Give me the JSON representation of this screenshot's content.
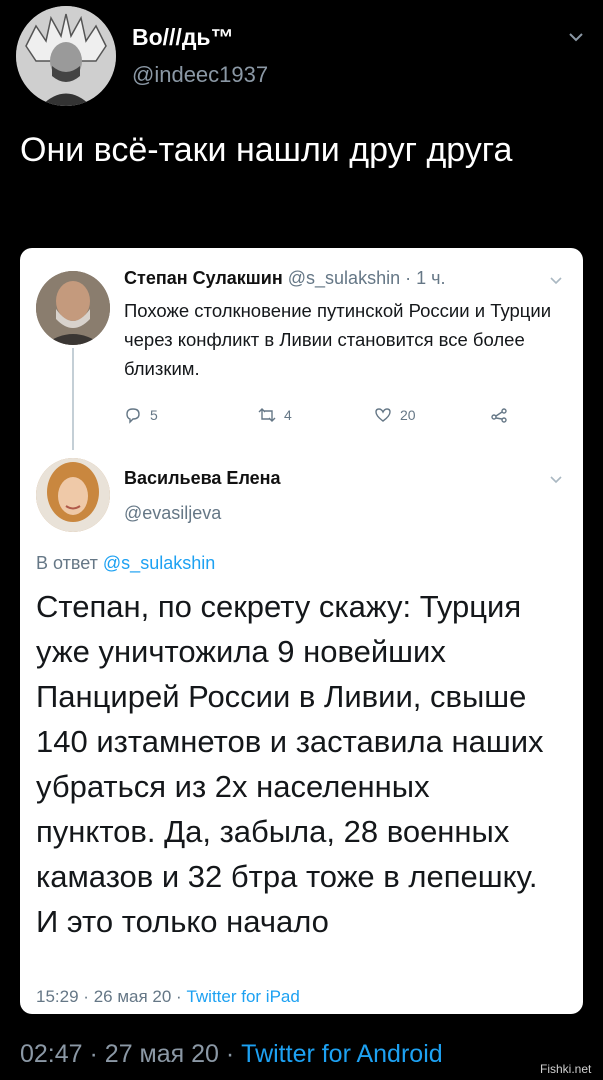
{
  "author": {
    "name": "Во///дь™",
    "handle": "@indeec1937"
  },
  "tweet": {
    "text": "Они всё-таки нашли друг друга",
    "time": "02:47",
    "date": "27 мая 20",
    "source": "Twitter for Android",
    "separator": "·"
  },
  "quoted_tweet": {
    "author_name": "Степан Сулакшин",
    "author_handle": "@s_sulakshin",
    "time_ago": "· 1 ч.",
    "text": "Похоже столкновение путинской России и Турции через конфликт в Ливии становится все более близким.",
    "replies": "5",
    "retweets": "4",
    "likes": "20"
  },
  "reply_tweet": {
    "author_name": "Васильева Елена",
    "author_handle": "@evasiljeva",
    "reply_prefix": "В ответ",
    "reply_mention": "@s_sulakshin",
    "text": "Степан, по секрету скажу: Турция уже уничтожила 9 новейших Панцирей России в Ливии, свыше 140 изтамнетов и заставила наших убраться из 2х населенных пунктов. Да, забыла, 28 военных камазов и 32 бтра тоже в лепешку. И это только начало",
    "time": "15:29",
    "date": "26 мая 20",
    "source": "Twitter for iPad",
    "separator": "·"
  },
  "watermark": "Fishki.net",
  "icons": {
    "reply": "reply-icon",
    "retweet": "retweet-icon",
    "like": "heart-icon",
    "share": "share-icon",
    "menu": "chevron-down-icon"
  },
  "colors": {
    "background": "#000000",
    "link": "#1da1f2",
    "muted": "#8b98a5"
  }
}
